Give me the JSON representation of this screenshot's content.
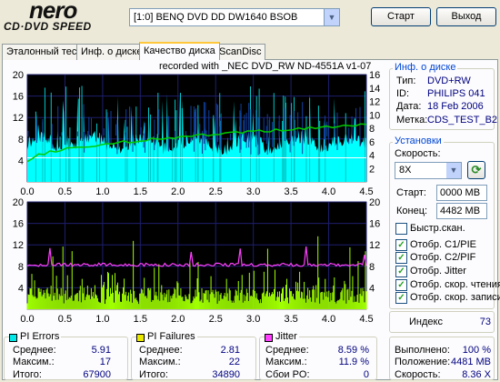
{
  "header": {
    "logo_big": "nero",
    "logo_small": "CD·DVD SPEED",
    "drive": "[1:0]  BENQ DVD DD DW1640 BSOB",
    "start_label": "Старт",
    "exit_label": "Выход"
  },
  "tabs": [
    "Эталонный тест",
    "Инф. о диске",
    "Качество диска",
    "ScanDisc"
  ],
  "recorded_with": "recorded with _NEC    DVD_RW ND-4551A  v1-07",
  "disc_info": {
    "title": "Инф. о диске",
    "type_label": "Тип:",
    "type_value": "DVD+RW",
    "id_label": "ID:",
    "id_value": "PHILIPS 041",
    "date_label": "Дата:",
    "date_value": "18 Feb 2006",
    "label_label": "Метка:",
    "label_value": "CDS_TEST_B2"
  },
  "settings": {
    "title": "Установки",
    "speed_label": "Скорость:",
    "speed_value": "8X",
    "start_label": "Старт:",
    "start_value": "0000 MB",
    "end_label": "Конец:",
    "end_value": "4482 MB",
    "quick_scan": "Быстр.скан.",
    "checks": [
      "Отобр. C1/PIE",
      "Отобр. C2/PIF",
      "Отобр. Jitter",
      "Отобр. скор. чтения",
      "Отобр. скор. записи"
    ]
  },
  "index": {
    "label": "Индекс",
    "value": "73"
  },
  "stats": {
    "pie": {
      "title": "PI Errors",
      "avg_label": "Среднее:",
      "avg": "5.91",
      "max_label": "Максим.:",
      "max": "17",
      "total_label": "Итого:",
      "total": "67900",
      "color": "#00e8e8"
    },
    "pif": {
      "title": "PI Failures",
      "avg_label": "Среднее:",
      "avg": "2.81",
      "max_label": "Максим.:",
      "max": "22",
      "total_label": "Итого:",
      "total": "34890",
      "color": "#e8e800"
    },
    "jitter": {
      "title": "Jitter",
      "avg_label": "Среднее:",
      "avg": "8.59 %",
      "max_label": "Максим.:",
      "max": "11.9 %",
      "po_label": "Сбои PO:",
      "po": "0",
      "color": "#ff40ff"
    }
  },
  "progress": {
    "done_label": "Выполнено:",
    "done": "100 %",
    "pos_label": "Положение:",
    "pos": "4481 MB",
    "speed_label": "Скорость:",
    "speed": "8.36 X"
  },
  "chart_data": [
    {
      "type": "area",
      "series": [
        {
          "name": "PI Errors",
          "color": "#00ffff"
        },
        {
          "name": "Read speed",
          "color": "#00cc00"
        }
      ],
      "xlim": [
        0,
        4.5
      ],
      "xticks": [
        "0.0",
        "0.5",
        "1.0",
        "1.5",
        "2.0",
        "2.5",
        "3.0",
        "3.5",
        "4.0",
        "4.5"
      ],
      "ylim_left": [
        0,
        20
      ],
      "yticks_left": [
        "20",
        "16",
        "12",
        "8",
        "4"
      ],
      "ylim_right": [
        0,
        16
      ],
      "yticks_right": [
        "16",
        "14",
        "12",
        "10",
        "8",
        "6",
        "4",
        "2"
      ],
      "pie_max": 17,
      "speed_start": 3,
      "speed_end": 8.5
    },
    {
      "type": "area",
      "series": [
        {
          "name": "PI Failures",
          "color": "#a0ff00"
        },
        {
          "name": "Jitter",
          "color": "#ff40ff"
        }
      ],
      "xlim": [
        0,
        4.5
      ],
      "xticks": [
        "0.0",
        "0.5",
        "1.0",
        "1.5",
        "2.0",
        "2.5",
        "3.0",
        "3.5",
        "4.0",
        "4.5"
      ],
      "ylim_left": [
        0,
        20
      ],
      "yticks_left": [
        "20",
        "16",
        "12",
        "8",
        "4"
      ],
      "ylim_right": [
        0,
        20
      ],
      "yticks_right": [
        "20",
        "16",
        "12",
        "8",
        "4"
      ],
      "pif_max": 22,
      "jitter_avg": 8.59
    }
  ]
}
